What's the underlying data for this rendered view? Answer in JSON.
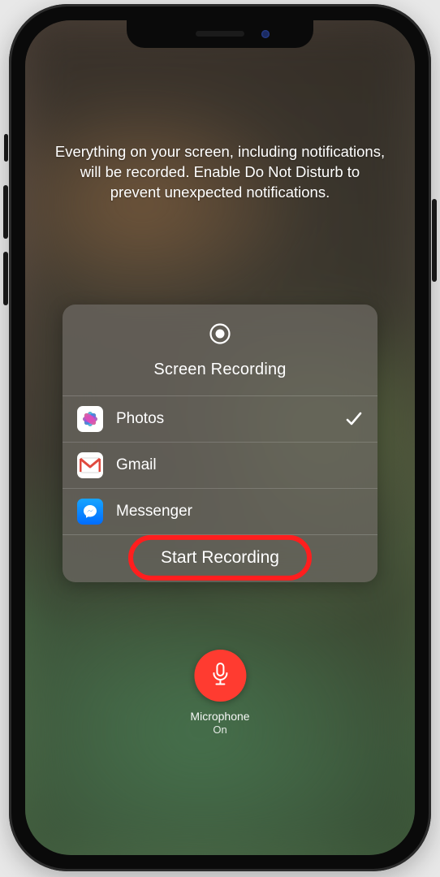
{
  "info_text": "Everything on your screen, including notifications, will be recorded. Enable Do Not Disturb to prevent unexpected notifications.",
  "panel": {
    "title": "Screen Recording",
    "apps": [
      {
        "name": "Photos",
        "icon": "photos-icon",
        "selected": true
      },
      {
        "name": "Gmail",
        "icon": "gmail-icon",
        "selected": false
      },
      {
        "name": "Messenger",
        "icon": "messenger-icon",
        "selected": false
      }
    ],
    "action_label": "Start Recording"
  },
  "microphone": {
    "label": "Microphone",
    "state": "On"
  },
  "colors": {
    "accent_red": "#ff3b30",
    "highlight": "#ff1e1e"
  }
}
